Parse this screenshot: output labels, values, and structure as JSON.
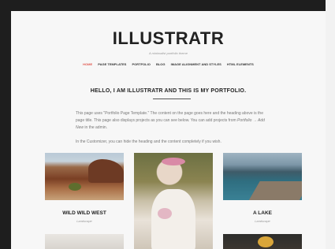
{
  "site": {
    "logo": "ILLUSTRATR",
    "tagline": "A minimalist portfolio theme"
  },
  "nav": {
    "items": [
      "HOME",
      "PAGE TEMPLATES",
      "PORTFOLIO",
      "BLOG",
      "IMAGE ALIGNMENT AND STYLES",
      "HTML ELEMENTS"
    ],
    "active": "HOME",
    "active_color": "#e0574f"
  },
  "main": {
    "heading": "HELLO, I AM ILLUSTRATR AND THIS IS MY PORTFOLIO.",
    "intro": {
      "p1_a": "This page uses \"Portfolio Page Template.\" The content on the page goes here and the heading above is the page title. This page also displays projects as you can see below. You can add projects from ",
      "p1_link": "Portfolio → Add New",
      "p1_b": " in the admin.",
      "p2": "In the Customizer, you can hide the heading and the content completely if you wish."
    }
  },
  "portfolio": {
    "items": [
      {
        "title": "WILD WILD WEST",
        "category": "Landscape",
        "image": "desert-photo"
      },
      {
        "title": "",
        "category": "",
        "image": "bride-photo"
      },
      {
        "title": "A LAKE",
        "category": "Landscape",
        "image": "lake-photo"
      },
      {
        "title": "",
        "category": "",
        "image": "wedding-table-photo"
      },
      {
        "title": "",
        "category": "",
        "image": "food-photo"
      }
    ]
  }
}
